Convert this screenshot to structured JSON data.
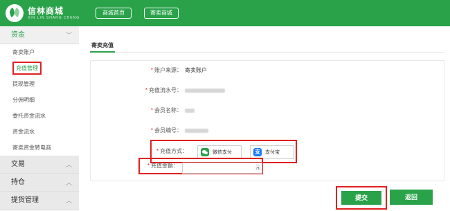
{
  "header": {
    "logo_title": "信林商城",
    "logo_sub": "XIN LIN SHANG CHENG",
    "nav": [
      {
        "label": "商城首页"
      },
      {
        "label": "寄卖商城"
      }
    ]
  },
  "sidebar": {
    "groups": [
      {
        "label": "资金",
        "items": [
          {
            "label": "寄卖账户"
          },
          {
            "label": "充值管理"
          },
          {
            "label": "提现管理"
          },
          {
            "label": "分佣明细"
          },
          {
            "label": "委托资金流水"
          },
          {
            "label": "资金流水"
          },
          {
            "label": "寄卖资金转电商"
          }
        ]
      },
      {
        "label": "交易"
      },
      {
        "label": "持仓"
      },
      {
        "label": "提货管理"
      }
    ]
  },
  "main": {
    "tab": "寄卖充值",
    "fields": {
      "account_source": {
        "label": "账户来源：",
        "value": "寄卖账户"
      },
      "serial_no": {
        "label": "充值流水号："
      },
      "member_name": {
        "label": "会员名称："
      },
      "member_id": {
        "label": "会员编号："
      },
      "pay_method": {
        "label": "充值方式：",
        "options": [
          {
            "label": "微信支付",
            "icon": "wechat-icon"
          },
          {
            "label": "支付宝",
            "icon": "alipay-icon"
          }
        ]
      },
      "amount": {
        "label": "充值金额：",
        "value": "",
        "unit": "元"
      }
    },
    "submit_label": "提交",
    "back_label": "返回"
  },
  "colors": {
    "brand": "#2aa24a",
    "highlight": "#e02020"
  }
}
